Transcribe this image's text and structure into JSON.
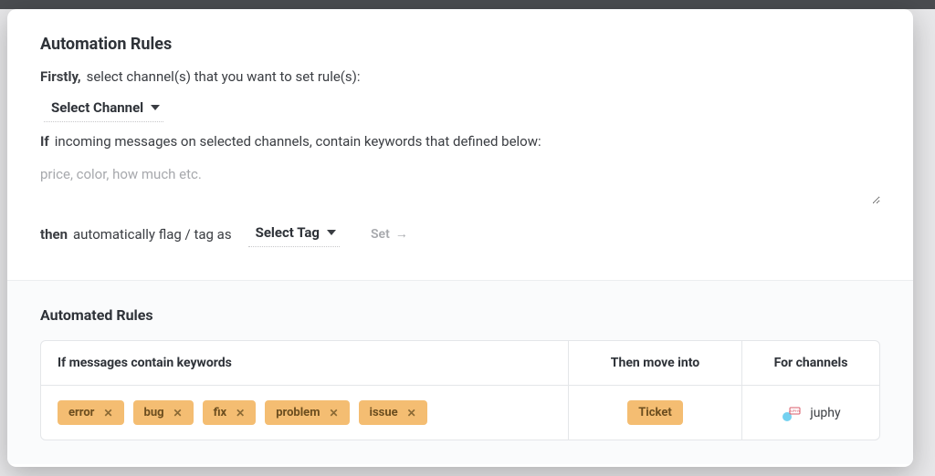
{
  "header": {
    "title": "Automation Rules",
    "firstly_bold": "Firstly,",
    "firstly_text": "select channel(s) that you want to set rule(s):",
    "select_channel_label": "Select Channel",
    "if_bold": "If",
    "if_text": "incoming messages on selected channels, contain keywords that defined below:",
    "keywords_placeholder": "price, color, how much etc.",
    "then_bold": "then",
    "then_text": "automatically flag / tag as",
    "select_tag_label": "Select Tag",
    "set_button_label": "Set"
  },
  "automated": {
    "title": "Automated Rules",
    "columns": {
      "keywords": "If messages contain keywords",
      "move": "Then move into",
      "channels": "For channels"
    },
    "rows": [
      {
        "keywords": [
          "error",
          "bug",
          "fix",
          "problem",
          "issue"
        ],
        "move_into": "Ticket",
        "channel": "juphy"
      }
    ]
  }
}
